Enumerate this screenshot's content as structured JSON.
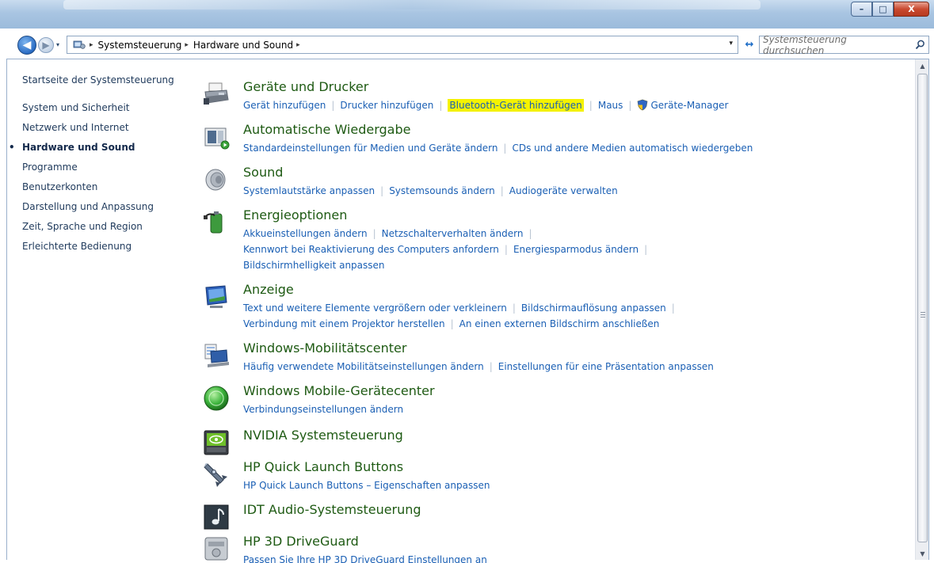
{
  "window": {
    "title_blur": "",
    "controls": {
      "minimize": "–",
      "maximize": "□",
      "close": "X"
    }
  },
  "nav": {
    "back_glyph": "◀",
    "forward_glyph": "▶",
    "history_glyph": "▾",
    "breadcrumb": [
      "Systemsteuerung",
      "Hardware und Sound"
    ],
    "crumb_separator": "▸",
    "address_dropdown": "▾",
    "refresh_glyph": "↔",
    "search_placeholder": "Systemsteuerung durchsuchen"
  },
  "sidebar": {
    "home": "Startseite der Systemsteuerung",
    "items": [
      {
        "label": "System und Sicherheit",
        "active": false
      },
      {
        "label": "Netzwerk und Internet",
        "active": false
      },
      {
        "label": "Hardware und Sound",
        "active": true
      },
      {
        "label": "Programme",
        "active": false
      },
      {
        "label": "Benutzerkonten",
        "active": false
      },
      {
        "label": "Darstellung und Anpassung",
        "active": false
      },
      {
        "label": "Zeit, Sprache und Region",
        "active": false
      },
      {
        "label": "Erleichterte Bedienung",
        "active": false
      }
    ],
    "bullet": "•"
  },
  "categories": {
    "geraete": {
      "title": "Geräte und Drucker",
      "icon": "printer-icon",
      "links": [
        "Gerät hinzufügen",
        "Drucker hinzufügen",
        "Bluetooth-Gerät hinzufügen",
        "Maus",
        "Geräte-Manager"
      ]
    },
    "autoplay": {
      "title": "Automatische Wiedergabe",
      "icon": "autoplay-icon",
      "links": [
        "Standardeinstellungen für Medien und Geräte ändern",
        "CDs und andere Medien automatisch wiedergeben"
      ]
    },
    "sound": {
      "title": "Sound",
      "icon": "speaker-icon",
      "links": [
        "Systemlautstärke anpassen",
        "Systemsounds ändern",
        "Audiogeräte verwalten"
      ]
    },
    "energie": {
      "title": "Energieoptionen",
      "icon": "battery-icon",
      "links": [
        "Akkueinstellungen ändern",
        "Netzschalterverhalten ändern",
        "Kennwort bei Reaktivierung des Computers anfordern",
        "Energiesparmodus ändern",
        "Bildschirmhelligkeit anpassen"
      ]
    },
    "anzeige": {
      "title": "Anzeige",
      "icon": "display-icon",
      "links": [
        "Text und weitere Elemente vergrößern oder verkleinern",
        "Bildschirmauflösung anpassen",
        "Verbindung mit einem Projektor herstellen",
        "An einen externen Bildschirm anschließen"
      ]
    },
    "mobility": {
      "title": "Windows-Mobilitätscenter",
      "icon": "mobility-icon",
      "links": [
        "Häufig verwendete Mobilitätseinstellungen ändern",
        "Einstellungen für eine Präsentation anpassen"
      ]
    },
    "mobile": {
      "title": "Windows Mobile-Gerätecenter",
      "icon": "sync-globe-icon",
      "links": [
        "Verbindungseinstellungen ändern"
      ]
    },
    "nvidia": {
      "title": "NVIDIA Systemsteuerung",
      "icon": "nvidia-icon",
      "links": []
    },
    "hpql": {
      "title": "HP Quick Launch Buttons",
      "icon": "rocket-icon",
      "links": [
        "HP Quick Launch Buttons – Eigenschaften anpassen"
      ]
    },
    "idt": {
      "title": "IDT Audio-Systemsteuerung",
      "icon": "music-note-icon",
      "links": []
    },
    "hp3d": {
      "title": "HP 3D DriveGuard",
      "icon": "drive-icon",
      "links": [
        "Passen Sie Ihre HP 3D DriveGuard Einstellungen an"
      ]
    }
  },
  "scrollbar": {
    "up": "▲",
    "down": "▼"
  }
}
